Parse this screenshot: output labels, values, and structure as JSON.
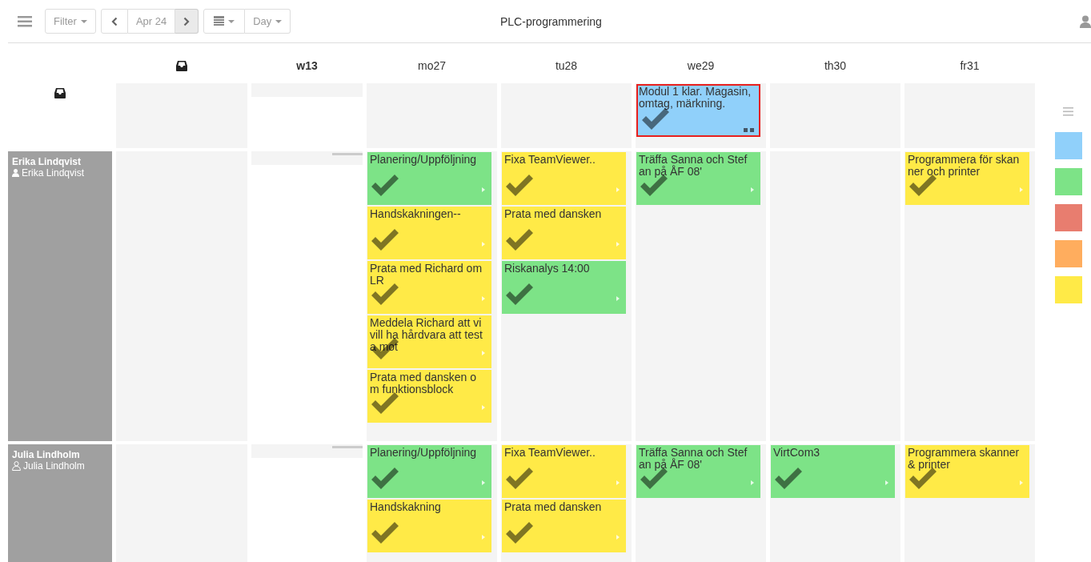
{
  "toolbar": {
    "filter": "Filter",
    "prev_pressed": false,
    "date": "Apr 24",
    "next_pressed": true,
    "view": "Day"
  },
  "title": "PLC-programmering",
  "headings": {
    "week": "w13",
    "days": [
      "mo27",
      "tu28",
      "we29",
      "th30",
      "fr31"
    ]
  },
  "inbox_row": {
    "days": [
      {
        "kind": "empty"
      },
      {
        "kind": "empty"
      },
      {
        "kind": "tasks",
        "cards": [
          {
            "text": "Modul 1 klar. Magasin, omtag, märkning.",
            "color": "#90d0fa",
            "selected": true
          }
        ]
      },
      {
        "kind": "empty"
      },
      {
        "kind": "empty"
      }
    ]
  },
  "people": [
    {
      "name": "Erika Lindqvist",
      "account": "Erika Lindqvist",
      "kind": "filled",
      "days": [
        {
          "kind": "tasks",
          "cards": [
            {
              "text": "Planering/Uppföljning",
              "color": "#7de387",
              "selected": false
            },
            {
              "text": "Handskakningen--",
              "color": "#ffea47",
              "selected": false
            },
            {
              "text": "Prata med Richard om LR",
              "color": "#ffea47",
              "selected": false
            },
            {
              "text": "Meddela Richard att vi vill ha hårdvara att testa mot",
              "color": "#ffea47",
              "selected": false
            },
            {
              "text": "Prata med dansken om funktionsblock",
              "color": "#ffea47",
              "selected": false
            }
          ]
        },
        {
          "kind": "tasks",
          "cards": [
            {
              "text": "Fixa TeamViewer..",
              "color": "#ffea47",
              "selected": false
            },
            {
              "text": "Prata med dansken",
              "color": "#ffea47",
              "selected": false
            },
            {
              "text": "Riskanalys 14:00",
              "color": "#7de387",
              "selected": false
            }
          ]
        },
        {
          "kind": "tasks",
          "cards": [
            {
              "text": "Träffa Sanna och Stefan på ÅF 08'",
              "color": "#7de387",
              "selected": false
            }
          ]
        },
        {
          "kind": "empty"
        },
        {
          "kind": "tasks",
          "cards": [
            {
              "text": "Programmera för skanner och printer",
              "color": "#ffea47",
              "selected": false
            }
          ]
        }
      ]
    },
    {
      "name": "Julia Lindholm",
      "account": "Julia Lindholm",
      "kind": "outline",
      "days": [
        {
          "kind": "tasks",
          "cards": [
            {
              "text": "Planering/Uppföljning",
              "color": "#7de387",
              "selected": false
            },
            {
              "text": "Handskakning",
              "color": "#ffea47",
              "selected": false
            }
          ]
        },
        {
          "kind": "tasks",
          "cards": [
            {
              "text": "Fixa TeamViewer..",
              "color": "#ffea47",
              "selected": false
            },
            {
              "text": "Prata med dansken",
              "color": "#ffea47",
              "selected": false
            }
          ]
        },
        {
          "kind": "tasks",
          "cards": [
            {
              "text": "Träffa Sanna och Stefan på ÅF 08'",
              "color": "#7de387",
              "selected": false
            }
          ]
        },
        {
          "kind": "tasks",
          "cards": [
            {
              "text": "VirtCom3",
              "color": "#7de387",
              "selected": false
            }
          ]
        },
        {
          "kind": "tasks",
          "cards": [
            {
              "text": "Programmera skanner & printer",
              "color": "#ffea47",
              "selected": false
            }
          ]
        }
      ]
    }
  ],
  "palette": [
    {
      "color": "#90d0fa"
    },
    {
      "color": "#7de387"
    },
    {
      "color": "#e87d6f"
    },
    {
      "color": "#ffad5e"
    },
    {
      "color": "#ffea47"
    }
  ]
}
